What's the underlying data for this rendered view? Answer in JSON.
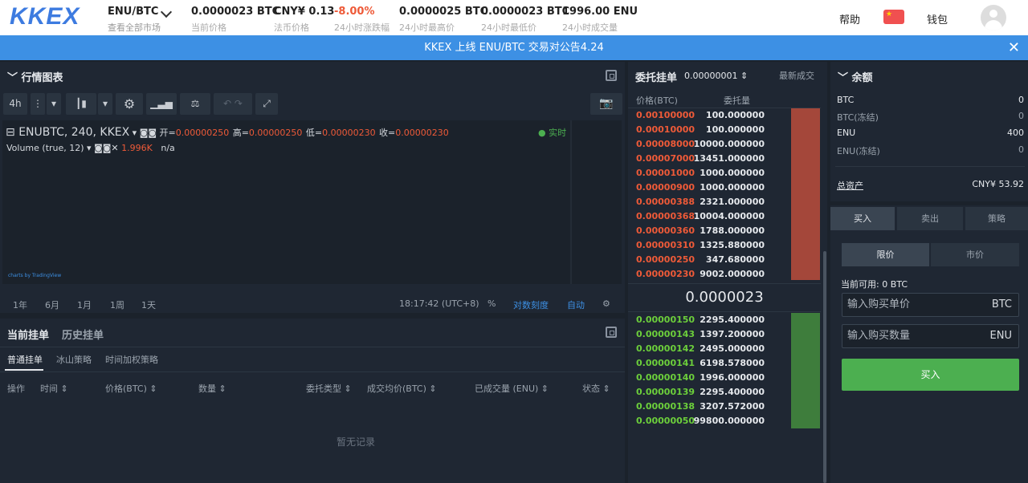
{
  "header": {
    "logo": "KKEX",
    "pair": "ENU/BTC",
    "pair_sub": "查看全部市场",
    "help": "帮助",
    "wallet": "钱包",
    "stats": [
      {
        "value": "0.0000023 BTC",
        "label": "当前价格"
      },
      {
        "value": "CNY¥ 0.13",
        "label": "法币价格"
      },
      {
        "value": "-8.00%",
        "label": "24小时涨跌幅"
      },
      {
        "value": "0.0000025 BTC",
        "label": "24小时最高价"
      },
      {
        "value": "0.0000023 BTC",
        "label": "24小时最低价"
      },
      {
        "value": "1996.00 ENU",
        "label": "24小时成交量"
      }
    ]
  },
  "announcement": "KKEX 上线 ENU/BTC 交易对公告4.24",
  "chart": {
    "title": "行情图表",
    "interval": "4h",
    "legend": {
      "symbol": "ENUBTC, 240, KKEX",
      "open_label": "开=",
      "open": "0.00000250",
      "high_label": "高=",
      "high": "0.00000250",
      "low_label": "低=",
      "low": "0.00000230",
      "close_label": "收=",
      "close": "0.00000230"
    },
    "volume": {
      "label": "Volume (true, 12)",
      "value": "1.996K",
      "extra": "n/a"
    },
    "realtime": "实时",
    "watermark": "charts by TradingView",
    "ranges": [
      "1年",
      "6月",
      "1月",
      "1周",
      "1天"
    ],
    "time": "18:17:42 (UTC+8)",
    "percent": "%",
    "log": "对数刻度",
    "auto": "自动"
  },
  "orders": {
    "tab_current": "当前挂单",
    "tab_history": "历史挂单",
    "subtabs": [
      "普通挂单",
      "冰山策略",
      "时间加权策略"
    ],
    "columns": [
      "操作",
      "时间",
      "价格(BTC)",
      "数量",
      "委托类型",
      "成交均价(BTC)",
      "已成交量 (ENU)",
      "状态"
    ],
    "empty": "暂无记录"
  },
  "orderbook": {
    "title": "委托挂单",
    "precision": "0.00000001",
    "latest_tab": "最新成交",
    "col_price": "价格(BTC)",
    "col_qty": "委托量",
    "last_price": "0.0000023",
    "asks": [
      [
        "0.00100000",
        "100.000000"
      ],
      [
        "0.00010000",
        "100.000000"
      ],
      [
        "0.00008000",
        "10000.000000"
      ],
      [
        "0.00007000",
        "13451.000000"
      ],
      [
        "0.00001000",
        "1000.000000"
      ],
      [
        "0.00000900",
        "1000.000000"
      ],
      [
        "0.00000388",
        "2321.000000"
      ],
      [
        "0.00000368",
        "10004.000000"
      ],
      [
        "0.00000360",
        "1788.000000"
      ],
      [
        "0.00000310",
        "1325.880000"
      ],
      [
        "0.00000250",
        "347.680000"
      ],
      [
        "0.00000230",
        "9002.000000"
      ]
    ],
    "bids": [
      [
        "0.00000150",
        "2295.400000"
      ],
      [
        "0.00000143",
        "1397.200000"
      ],
      [
        "0.00000142",
        "2495.000000"
      ],
      [
        "0.00000141",
        "6198.578000"
      ],
      [
        "0.00000140",
        "1996.000000"
      ],
      [
        "0.00000139",
        "2295.400000"
      ],
      [
        "0.00000138",
        "3207.572000"
      ],
      [
        "0.00000050",
        "99800.000000"
      ]
    ]
  },
  "balance": {
    "title": "余额",
    "rows": [
      [
        "BTC",
        "0"
      ],
      [
        "BTC(冻结)",
        "0"
      ],
      [
        "ENU",
        "400"
      ],
      [
        "ENU(冻结)",
        "0"
      ]
    ],
    "total_label": "总资产",
    "total": "CNY¥ 53.92"
  },
  "trade": {
    "tabs": [
      "买入",
      "卖出",
      "策略"
    ],
    "type_limit": "限价",
    "type_market": "市价",
    "available": "当前可用: 0 BTC",
    "price_placeholder": "输入购买单价",
    "price_unit": "BTC",
    "qty_placeholder": "输入购买数量",
    "qty_unit": "ENU",
    "buy_button": "买入"
  },
  "colors": {
    "ask": "#ee5a38",
    "bid": "#6ccf3b",
    "accent": "#3d90e4",
    "buy": "#4caf50"
  }
}
